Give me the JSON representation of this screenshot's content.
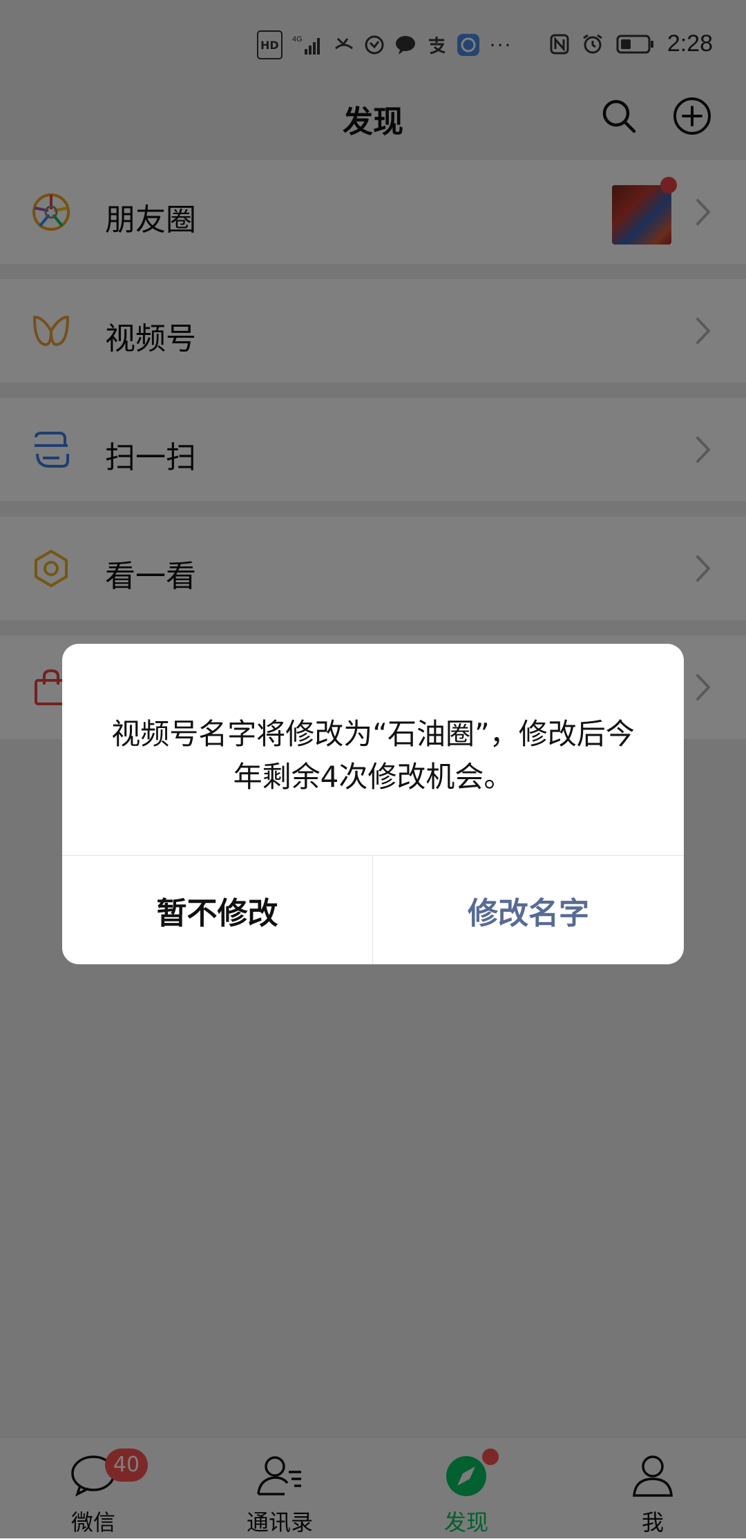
{
  "status_bar": {
    "network_badge": "HD",
    "network_type": "4G",
    "more": "···",
    "time": "2:28"
  },
  "header": {
    "title": "发现"
  },
  "list": [
    {
      "label": "朋友圈",
      "icon": "moments-icon",
      "has_thumbnail": true,
      "has_dot": true
    },
    {
      "label": "视频号",
      "icon": "channels-icon"
    },
    {
      "label": "扫一扫",
      "icon": "scan-icon"
    },
    {
      "label": "看一看",
      "icon": "top-stories-icon"
    },
    {
      "label": "",
      "icon": "shopping-icon"
    }
  ],
  "dialog": {
    "message": "视频号名字将修改为“石油圈”，修改后今年剩余4次修改机会。",
    "cancel_label": "暂不修改",
    "confirm_label": "修改名字"
  },
  "tabbar": {
    "tabs": [
      {
        "label": "微信",
        "badge": "40"
      },
      {
        "label": "通讯录"
      },
      {
        "label": "发现",
        "active": true,
        "has_dot": true
      },
      {
        "label": "我"
      }
    ]
  },
  "colors": {
    "accent_green": "#07c160",
    "badge_red": "#fa5151",
    "dialog_confirm": "#576b95",
    "page_bg": "#ededed"
  }
}
